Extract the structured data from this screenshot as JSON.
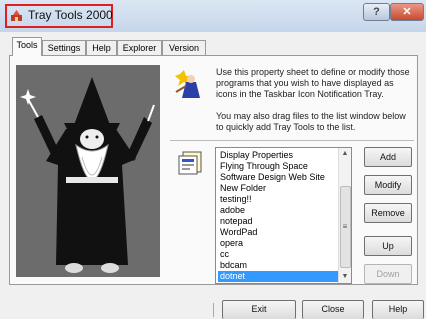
{
  "window": {
    "title": "Tray Tools 2000",
    "help_glyph": "?",
    "close_glyph": "✕"
  },
  "tabs": [
    "Tools",
    "Settings",
    "Help",
    "Explorer",
    "Version"
  ],
  "description": {
    "line1": "Use this property sheet to define or modify those",
    "line2": "programs that you wish to have displayed as",
    "line3": "icons in the Taskbar Icon Notification Tray.",
    "line4": "You may also drag files to the list window below",
    "line5": "to quickly add Tray Tools to the list."
  },
  "tools_list": {
    "items": [
      "Display Properties",
      "Flying Through Space",
      "Software Design Web Site",
      "New Folder",
      "testing!!",
      "adobe",
      "notepad",
      "WordPad",
      "opera",
      "cc",
      "bdcam",
      "dotnet"
    ],
    "selected": "dotnet",
    "scroll_up": "▲",
    "scroll_down": "▼",
    "grip": "≡"
  },
  "side_buttons": {
    "add": "Add",
    "modify": "Modify",
    "remove": "Remove",
    "up": "Up",
    "down": "Down"
  },
  "bottom_buttons": {
    "exit": "Exit",
    "close": "Close",
    "help": "Help"
  },
  "colors": {
    "selection": "#3399ff",
    "title_highlight": "#e02020",
    "wizard_bg": "#6c6c6c"
  }
}
